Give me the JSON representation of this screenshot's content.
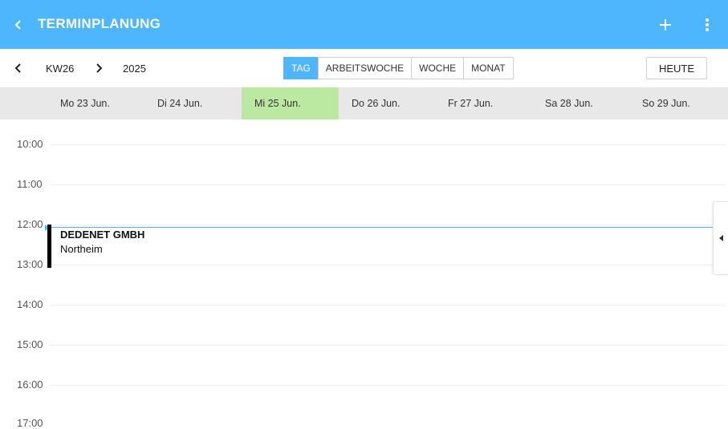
{
  "header": {
    "title": "TERMINPLANUNG",
    "colors": {
      "appbar": "#4db6fc",
      "text": "#ffffff"
    }
  },
  "toolbar": {
    "week_label": "KW26",
    "year_label": "2025",
    "views": [
      {
        "label": "TAG",
        "active": true
      },
      {
        "label": "ARBEITSWOCHE",
        "active": false
      },
      {
        "label": "WOCHE",
        "active": false
      },
      {
        "label": "MONAT",
        "active": false
      }
    ],
    "today_label": "HEUTE"
  },
  "days": [
    {
      "label": "Mo 23 Jun.",
      "selected": false
    },
    {
      "label": "Di 24 Jun.",
      "selected": false
    },
    {
      "label": "Mi 25 Jun.",
      "selected": true
    },
    {
      "label": "Do 26 Jun.",
      "selected": false
    },
    {
      "label": "Fr 27 Jun.",
      "selected": false
    },
    {
      "label": "Sa 28 Jun.",
      "selected": false
    },
    {
      "label": "So 29 Jun.",
      "selected": false
    }
  ],
  "hours": [
    "10:00",
    "11:00",
    "12:00",
    "13:00",
    "14:00",
    "15:00",
    "16:00",
    "17:00"
  ],
  "event": {
    "title": "DEDENET GMBH",
    "location": "Northeim"
  },
  "colors": {
    "selected_day": "#bce9a2",
    "active_view": "#4db6fc",
    "now_line": "#4db6fc"
  }
}
